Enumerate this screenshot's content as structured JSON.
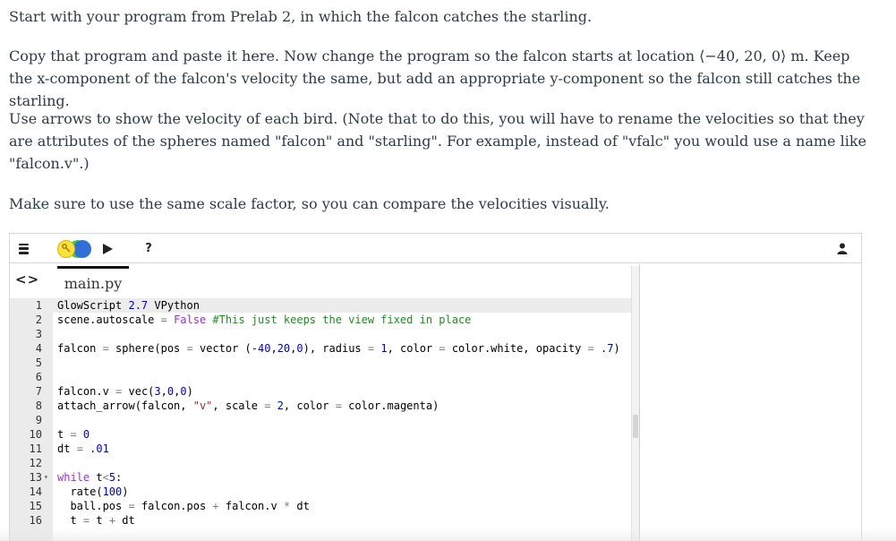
{
  "instructions": {
    "p1": "Start with your program from Prelab 2, in which the falcon catches the starling.",
    "p2_a": "Copy that program and paste it here. Now change the program so the falcon starts at location ",
    "p2_vec": "⟨−40, 20, 0⟩",
    "p2_b": " m. Keep the x-component of the falcon's velocity the same, but add an appropriate y-component so the falcon still catches the starling.",
    "p3": "Use arrows to show the velocity of each bird. (Note that to do this, you will have to rename the velocities so that they are attributes of the spheres named \"falcon\" and \"starling\". For example, instead of \"vfalc\" you would use a name like \"falcon.v\".)",
    "p4": "Make sure to use the same scale factor, so you can compare the velocities visually."
  },
  "toolbar": {
    "menu_icon": "hamburger-menu-icon",
    "logo_icon": "glowscript-logo-icon",
    "run_icon": "play-icon",
    "help_label": "?",
    "user_icon": "user-icon"
  },
  "editor": {
    "nav_label": "<>",
    "file_tab": "main.py",
    "lines": [
      {
        "n": "1",
        "parts": [
          [
            "GlowScript ",
            ""
          ],
          [
            "2.7",
            "num"
          ],
          [
            " VPython",
            ""
          ]
        ]
      },
      {
        "n": "2",
        "parts": [
          [
            "scene.autoscale ",
            ""
          ],
          [
            "=",
            "op"
          ],
          [
            " ",
            ""
          ],
          [
            "False",
            "kw"
          ],
          [
            " ",
            ""
          ],
          [
            "#This just keeps the view fixed in place",
            "cmt"
          ]
        ]
      },
      {
        "n": "3",
        "parts": []
      },
      {
        "n": "4",
        "parts": [
          [
            "falcon ",
            ""
          ],
          [
            "=",
            "op"
          ],
          [
            " sphere(pos ",
            ""
          ],
          [
            "=",
            "op"
          ],
          [
            " vector (",
            ""
          ],
          [
            "-40",
            "num"
          ],
          [
            ",",
            ""
          ],
          [
            "20",
            "num"
          ],
          [
            ",",
            ""
          ],
          [
            "0",
            "num"
          ],
          [
            "), radius ",
            ""
          ],
          [
            "=",
            "op"
          ],
          [
            " ",
            ""
          ],
          [
            "1",
            "num"
          ],
          [
            ", color ",
            ""
          ],
          [
            "=",
            "op"
          ],
          [
            " color.white, opacity ",
            ""
          ],
          [
            "=",
            "op"
          ],
          [
            " ",
            ""
          ],
          [
            ".7",
            "num"
          ],
          [
            ")",
            ""
          ]
        ]
      },
      {
        "n": "5",
        "parts": []
      },
      {
        "n": "6",
        "parts": []
      },
      {
        "n": "7",
        "parts": [
          [
            "falcon.v ",
            ""
          ],
          [
            "=",
            "op"
          ],
          [
            " vec(",
            ""
          ],
          [
            "3",
            "num"
          ],
          [
            ",",
            ""
          ],
          [
            "0",
            "num"
          ],
          [
            ",",
            ""
          ],
          [
            "0",
            "num"
          ],
          [
            ")",
            ""
          ]
        ]
      },
      {
        "n": "8",
        "parts": [
          [
            "attach_arrow(falcon, ",
            ""
          ],
          [
            "\"v\"",
            "str"
          ],
          [
            ", scale ",
            ""
          ],
          [
            "=",
            "op"
          ],
          [
            " ",
            ""
          ],
          [
            "2",
            "num"
          ],
          [
            ", color ",
            ""
          ],
          [
            "=",
            "op"
          ],
          [
            " color.magenta)",
            ""
          ]
        ]
      },
      {
        "n": "9",
        "parts": []
      },
      {
        "n": "10",
        "parts": [
          [
            "t ",
            ""
          ],
          [
            "=",
            "op"
          ],
          [
            " ",
            ""
          ],
          [
            "0",
            "num"
          ]
        ]
      },
      {
        "n": "11",
        "parts": [
          [
            "dt ",
            ""
          ],
          [
            "=",
            "op"
          ],
          [
            " ",
            ""
          ],
          [
            ".01",
            "num"
          ]
        ]
      },
      {
        "n": "12",
        "parts": []
      },
      {
        "n": "13",
        "fold": true,
        "parts": [
          [
            "while",
            "kw"
          ],
          [
            " t",
            ""
          ],
          [
            "<",
            "op"
          ],
          [
            "5",
            "num"
          ],
          [
            ":",
            ""
          ]
        ]
      },
      {
        "n": "14",
        "parts": [
          [
            "  rate(",
            ""
          ],
          [
            "100",
            "num"
          ],
          [
            ")",
            ""
          ]
        ]
      },
      {
        "n": "15",
        "parts": [
          [
            "  ball.pos ",
            ""
          ],
          [
            "=",
            "op"
          ],
          [
            " falcon.pos ",
            ""
          ],
          [
            "+",
            "op"
          ],
          [
            " falcon.v ",
            ""
          ],
          [
            "*",
            "op"
          ],
          [
            " dt",
            ""
          ]
        ]
      },
      {
        "n": "16",
        "parts": [
          [
            "  t ",
            ""
          ],
          [
            "=",
            "op"
          ],
          [
            " t ",
            ""
          ],
          [
            "+",
            "op"
          ],
          [
            " dt",
            ""
          ]
        ]
      }
    ]
  }
}
